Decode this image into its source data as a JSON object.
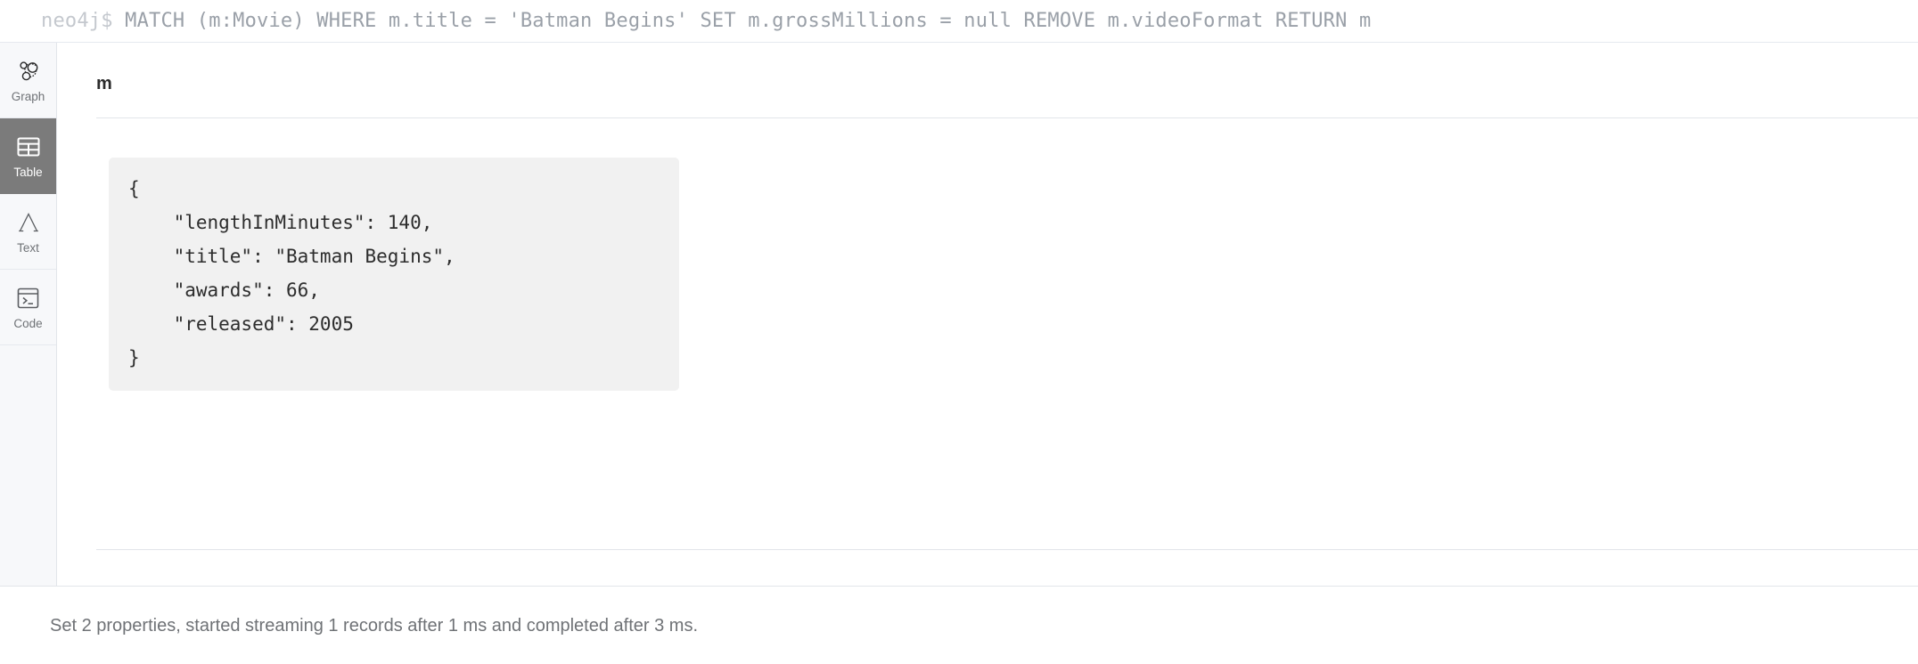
{
  "query_bar": {
    "prompt": "neo4j$ ",
    "query": "MATCH (m:Movie) WHERE m.title = 'Batman Begins' SET m.grossMillions = null REMOVE m.videoFormat RETURN m"
  },
  "sidebar": {
    "items": [
      {
        "label": "Graph",
        "icon": "graph-icon",
        "active": false
      },
      {
        "label": "Table",
        "icon": "table-icon",
        "active": true
      },
      {
        "label": "Text",
        "icon": "text-icon",
        "active": false
      },
      {
        "label": "Code",
        "icon": "code-icon",
        "active": false
      }
    ]
  },
  "result": {
    "column_name": "m",
    "json_lines": [
      "{",
      "    \"lengthInMinutes\": 140,",
      "    \"title\": \"Batman Begins\",",
      "    \"awards\": 66,",
      "    \"released\": 2005",
      "}"
    ]
  },
  "status": {
    "message": "Set 2 properties, started streaming 1 records after 1 ms and completed after 3 ms."
  },
  "colors": {
    "active_tab_bg": "#7b7b7b",
    "sidebar_bg": "#f7f8fa",
    "json_card_bg": "#f1f1f1",
    "query_text": "#9aa0a8",
    "divider": "#e2e5ea"
  }
}
